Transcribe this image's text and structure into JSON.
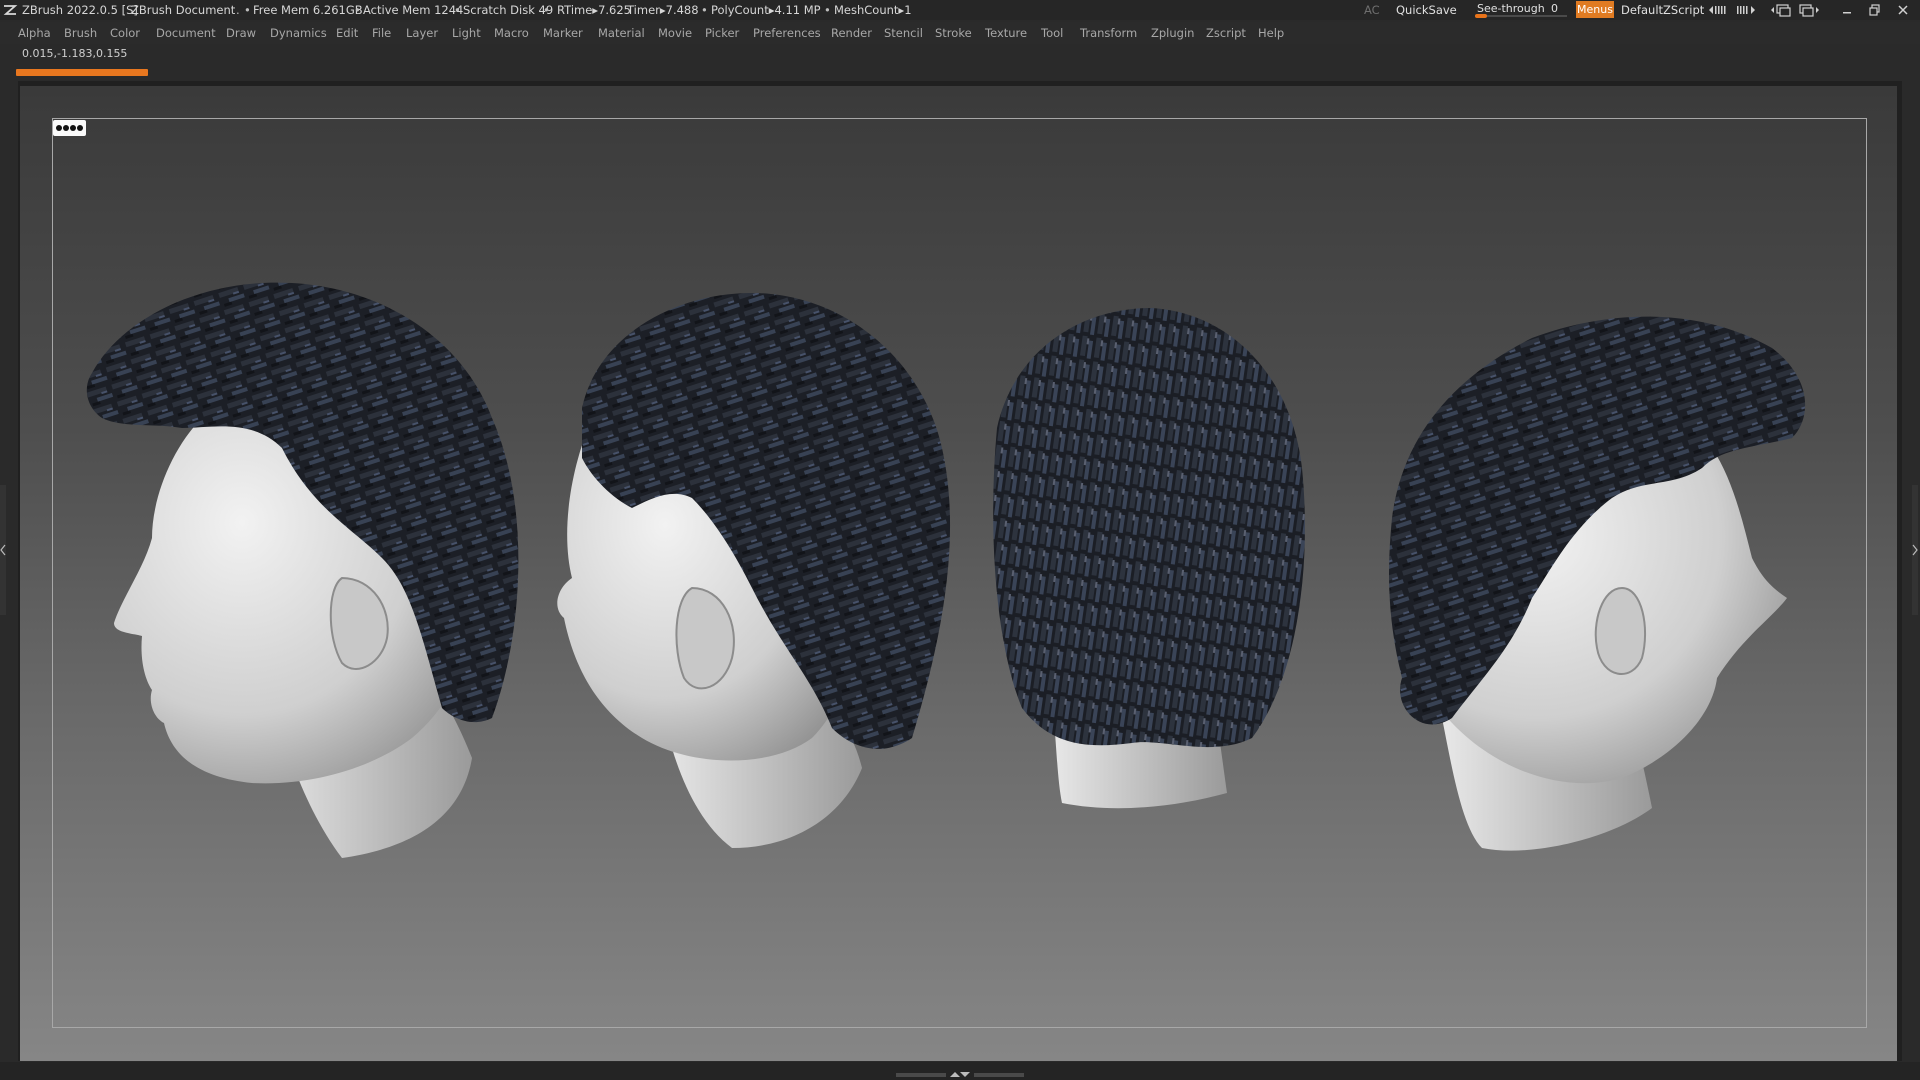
{
  "titlebar": {
    "app_title": "ZBrush 2022.0.5 [S]",
    "document_title": "ZBrush Document",
    "stats": {
      "free_mem": "Free Mem 6.261GB",
      "active_mem": "Active Mem 1244",
      "scratch_disk": "Scratch Disk 49",
      "rtime": "RTime▸7.625",
      "timer": "Timer▸7.488",
      "polycount": "PolyCount▸4.11 MP",
      "meshcount": "MeshCount▸1"
    },
    "ac_label": "AC",
    "quicksave_label": "QuickSave",
    "seethrough": {
      "label": "See-through",
      "value": "0",
      "level": 0
    },
    "menus_label": "Menus",
    "script_name": "DefaultZScript",
    "icons": [
      "layout-prev-icon",
      "layout-next-icon",
      "popup-window-icon",
      "dock-window-icon",
      "minimize-icon",
      "restore-icon",
      "close-icon"
    ]
  },
  "menubar": {
    "items": [
      "Alpha",
      "Brush",
      "Color",
      "Document",
      "Draw",
      "Dynamics",
      "Edit",
      "File",
      "Layer",
      "Light",
      "Macro",
      "Marker",
      "Material",
      "Movie",
      "Picker",
      "Preferences",
      "Render",
      "Stencil",
      "Stroke",
      "Texture",
      "Tool",
      "Transform",
      "Zplugin",
      "Zscript",
      "Help"
    ]
  },
  "info": {
    "coordinates": "0.015,-1.183,0.155",
    "progress": 0.07
  },
  "colors": {
    "accent": "#e8771f",
    "titlebar_bg": "#262626",
    "menubar_bg": "#2b2b2b",
    "canvas_top": "#3a3a3a",
    "canvas_bottom": "#868686",
    "skin": "#d0d0d0",
    "hair": "#1e2128"
  },
  "viewport": {
    "views": [
      "head-left-profile",
      "head-back-three-quarter-left",
      "head-back",
      "head-right-profile"
    ]
  }
}
